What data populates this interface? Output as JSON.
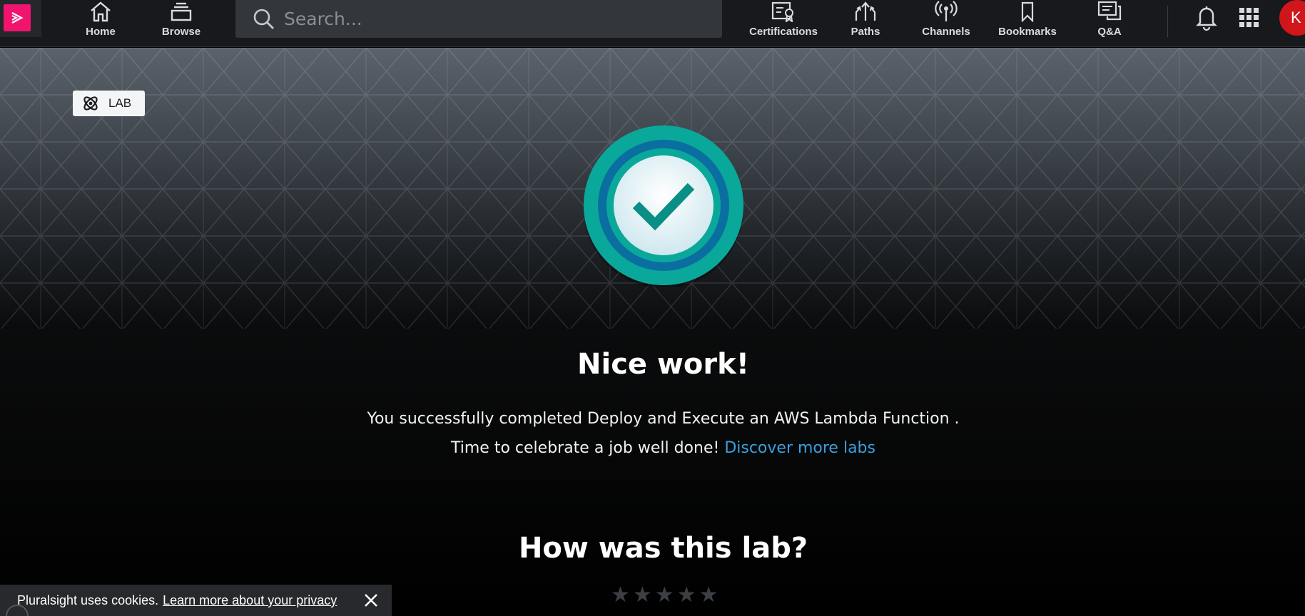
{
  "nav": {
    "items": [
      {
        "label": "Home",
        "icon": "home-icon"
      },
      {
        "label": "Browse",
        "icon": "browse-icon"
      },
      {
        "label": "Certifications",
        "icon": "certifications-icon"
      },
      {
        "label": "Paths",
        "icon": "paths-icon"
      },
      {
        "label": "Channels",
        "icon": "channels-icon"
      },
      {
        "label": "Bookmarks",
        "icon": "bookmarks-icon"
      },
      {
        "label": "Q&A",
        "icon": "qa-icon"
      }
    ],
    "search_placeholder": "Search...",
    "avatar_initial": "K"
  },
  "hero": {
    "badge_label": "LAB"
  },
  "result": {
    "title": "Nice work!",
    "message": "You successfully completed Deploy and Execute an AWS Lambda Function .",
    "celebrate": "Time to celebrate a job well done!",
    "discover_link": "Discover more labs"
  },
  "rating": {
    "question": "How was this lab?",
    "stars": [
      "★",
      "★",
      "★",
      "★",
      "★"
    ]
  },
  "cookie": {
    "text": "Pluralsight uses cookies.",
    "link": "Learn more about your privacy"
  },
  "colors": {
    "brand": "#f0146e",
    "accent_link": "#3aa0e0",
    "medal_teal": "#0aa89a",
    "avatar": "#d0151b"
  }
}
